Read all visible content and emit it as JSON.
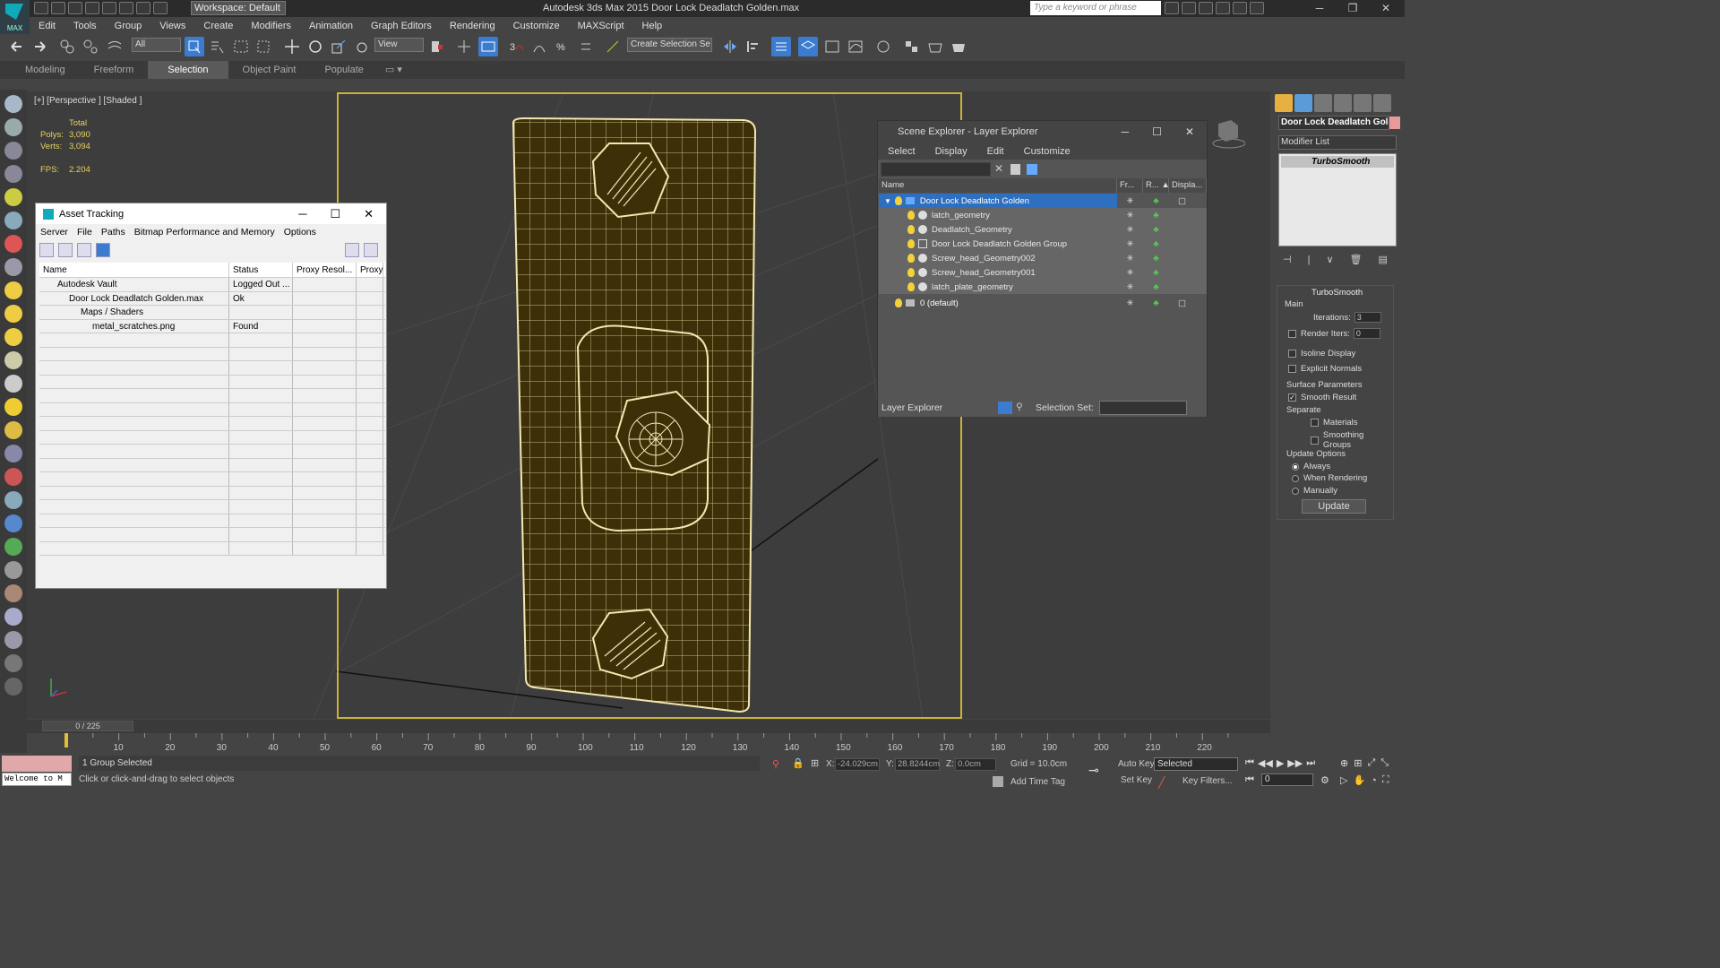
{
  "app": {
    "title": "Autodesk 3ds Max  2015     Door Lock Deadlatch Golden.max",
    "logo": "MAX",
    "workspace": "Workspace: Default",
    "search_placeholder": "Type a keyword or phrase",
    "win_minimize": "─",
    "win_restore": "❐",
    "win_close": "✕"
  },
  "menu": [
    "Edit",
    "Tools",
    "Group",
    "Views",
    "Create",
    "Modifiers",
    "Animation",
    "Graph Editors",
    "Rendering",
    "Customize",
    "MAXScript",
    "Help"
  ],
  "toolbar": {
    "filter": "All",
    "ref_coord": "View",
    "named_selection": "Create Selection Se"
  },
  "ribbon": {
    "tabs": [
      "Modeling",
      "Freeform",
      "Selection",
      "Object Paint",
      "Populate"
    ],
    "active": "Selection"
  },
  "viewport": {
    "label": "[+] [Perspective ] [Shaded ]",
    "stats": {
      "total_label": "Total",
      "polys_label": "Polys:",
      "polys": "3,090",
      "verts_label": "Verts:",
      "verts": "3,094",
      "fps_label": "FPS:",
      "fps": "2.204"
    }
  },
  "asset_tracking": {
    "title": "Asset Tracking",
    "menu": [
      "Server",
      "File",
      "Paths",
      "Bitmap Performance and Memory",
      "Options"
    ],
    "columns": [
      "Name",
      "Status",
      "Proxy Resol...",
      "Proxy"
    ],
    "rows": [
      {
        "name": "Autodesk Vault",
        "status": "Logged Out ...",
        "indent": 0
      },
      {
        "name": "Door Lock Deadlatch Golden.max",
        "status": "Ok",
        "indent": 1
      },
      {
        "name": "Maps / Shaders",
        "status": "",
        "indent": 2
      },
      {
        "name": "metal_scratches.png",
        "status": "Found",
        "indent": 3
      }
    ],
    "scroll_left": "<",
    "scroll_right": ">"
  },
  "scene_explorer": {
    "title": "Scene Explorer - Layer Explorer",
    "menu": [
      "Select",
      "Display",
      "Edit",
      "Customize"
    ],
    "columns": [
      "Name",
      "Fr...",
      "R... ▲",
      "Displa..."
    ],
    "rows": [
      {
        "name": "Door Lock Deadlatch Golden",
        "type": "layer",
        "selected": true
      },
      {
        "name": "latch_geometry",
        "type": "object"
      },
      {
        "name": "Deadlatch_Geometry",
        "type": "object"
      },
      {
        "name": "Door Lock Deadlatch Golden Group",
        "type": "group"
      },
      {
        "name": "Screw_head_Geometry002",
        "type": "object"
      },
      {
        "name": "Screw_head_Geometry001",
        "type": "object"
      },
      {
        "name": "latch_plate_geometry",
        "type": "object"
      },
      {
        "name": "0 (default)",
        "type": "layer"
      }
    ],
    "explorer_type": "Layer Explorer",
    "selection_set_label": "Selection Set:"
  },
  "command_panel": {
    "object_name": "Door Lock Deadlatch Golden",
    "object_color": "#e89a9a",
    "modifier_list": "Modifier List",
    "stack_item": "TurboSmooth",
    "turbosmooth": {
      "title": "TurboSmooth",
      "main": "Main",
      "iterations_label": "Iterations:",
      "iterations": "3",
      "render_iters_label": "Render Iters:",
      "render_iters": "0",
      "isoline": "Isoline Display",
      "explicit_normals": "Explicit Normals",
      "surface_params": "Surface Parameters",
      "smooth_result": "Smooth Result",
      "separate": "Separate",
      "materials": "Materials",
      "smoothing_groups": "Smoothing Groups",
      "update_options": "Update Options",
      "always": "Always",
      "when_rendering": "When Rendering",
      "manually": "Manually",
      "update_btn": "Update"
    }
  },
  "timeline": {
    "frame": "0 / 225",
    "ticks": [
      "10",
      "20",
      "30",
      "40",
      "50",
      "60",
      "70",
      "80",
      "90",
      "100",
      "110",
      "120",
      "130",
      "140",
      "150",
      "160",
      "170",
      "180",
      "190",
      "200",
      "210",
      "220"
    ]
  },
  "status": {
    "maxscript": "Welcome to M",
    "selection": "1 Group Selected",
    "prompt": "Click or click-and-drag to select objects",
    "x_label": "X:",
    "x": "-24.029cm",
    "y_label": "Y:",
    "y": "28.8244cm",
    "z_label": "Z:",
    "z": "0.0cm",
    "grid": "Grid = 10.0cm",
    "add_time_tag": "Add Time Tag",
    "auto_key": "Auto Key",
    "set_key": "Set Key",
    "key_mode": "Selected",
    "key_filters": "Key Filters...",
    "frame_value": "0"
  },
  "colors": {
    "accent": "#3b7bd0",
    "viewport_border": "#c9b33a",
    "stats": "#e9d25c",
    "wire": "#f2e8b0",
    "object_fill": "#3d3008"
  }
}
